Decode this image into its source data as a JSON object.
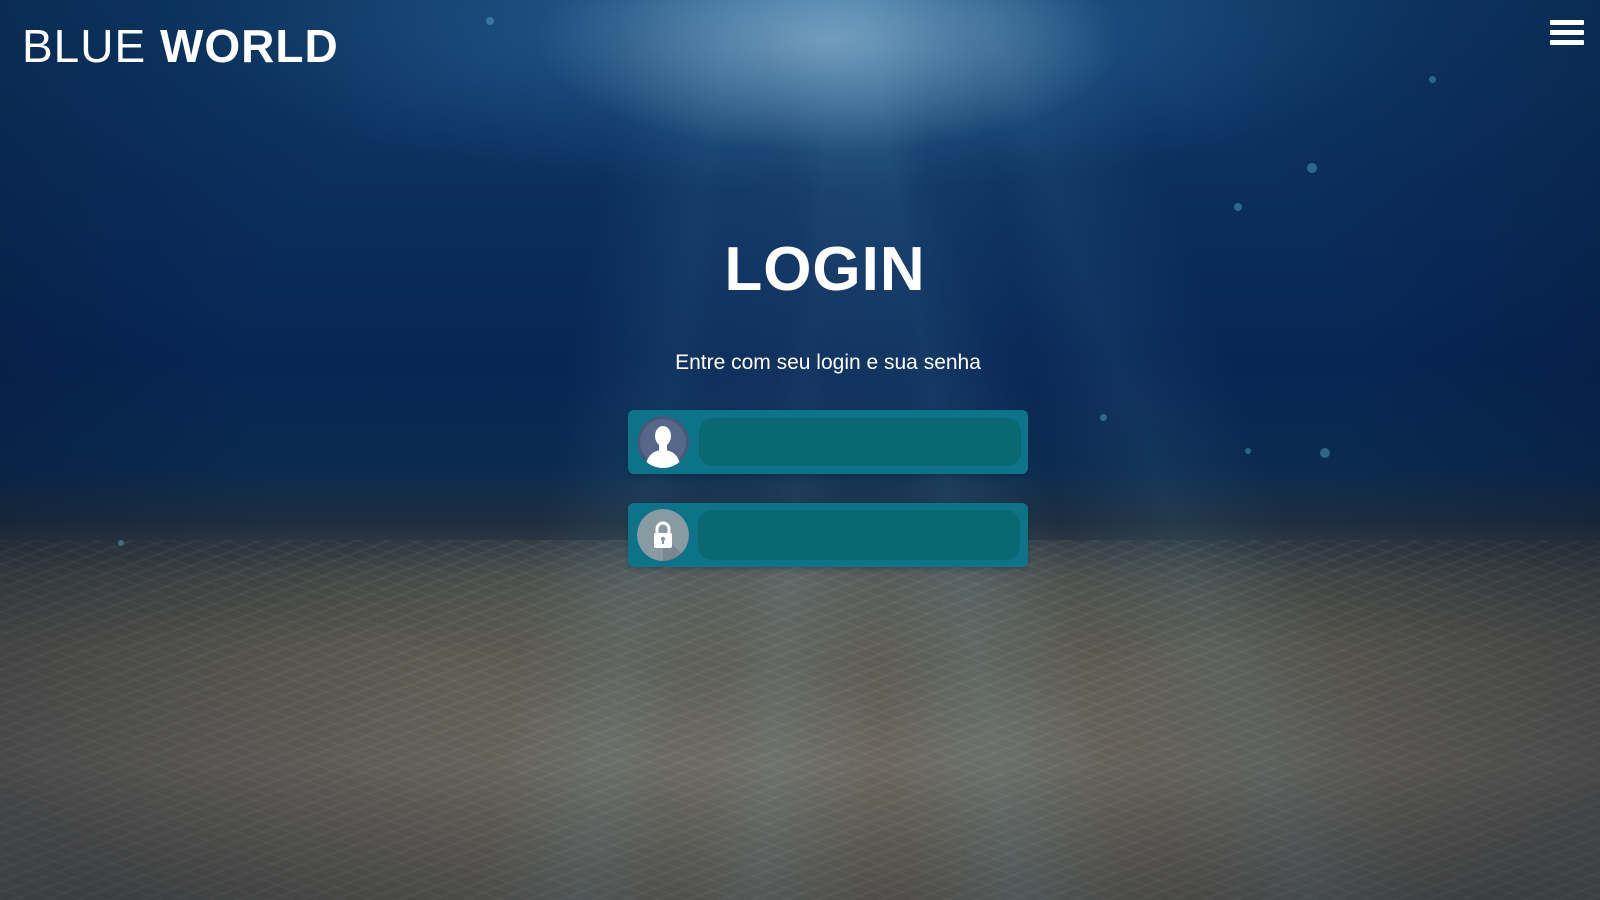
{
  "header": {
    "brand_light": "BLUE",
    "brand_bold": "WORLD",
    "menu_icon": "hamburger-menu-icon"
  },
  "login": {
    "title": "LOGIN",
    "subtitle": "Entre com seu login e sua senha",
    "username": {
      "icon": "user-avatar-icon",
      "value": "",
      "placeholder": ""
    },
    "password": {
      "icon": "lock-icon",
      "value": "",
      "placeholder": ""
    }
  },
  "colors": {
    "field_bg": "#0d7389",
    "input_bg": "#0a6873",
    "text": "#ffffff",
    "water_top": "#0f3d6e",
    "sand": "#6b675e"
  }
}
